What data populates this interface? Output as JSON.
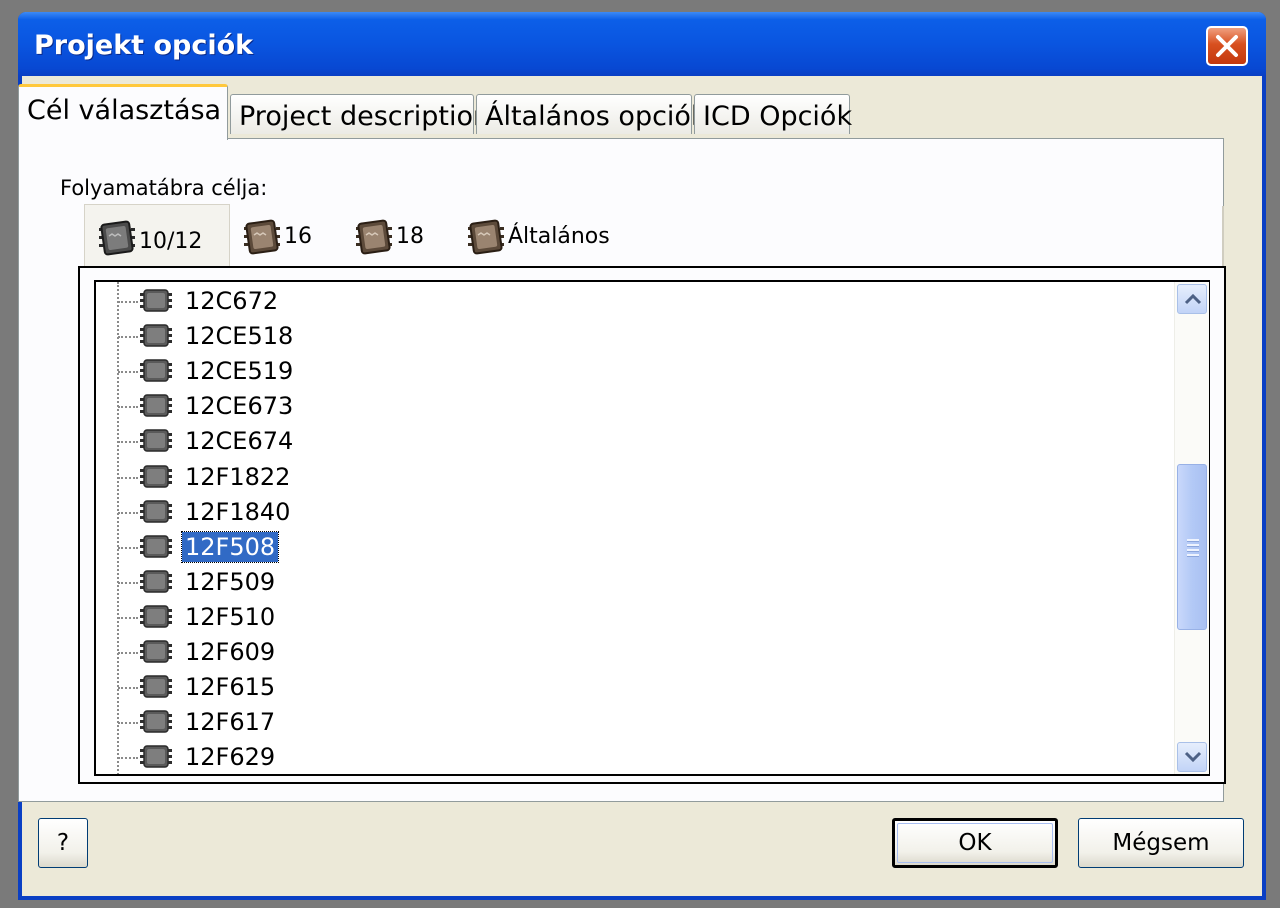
{
  "window": {
    "title": "Projekt opciók",
    "accent": "#0a55e0",
    "close_color": "#d8501f"
  },
  "tabs": [
    {
      "label": "Cél választása",
      "active": true
    },
    {
      "label": "Project description",
      "active": false
    },
    {
      "label": "Általános opciók",
      "active": false
    },
    {
      "label": "ICD Opciók",
      "active": false
    }
  ],
  "panel": {
    "label": "Folyamatábra célja:"
  },
  "subtabs": [
    {
      "label": "10/12",
      "icon": "chip-icon",
      "active": true
    },
    {
      "label": "16",
      "icon": "chip-icon",
      "active": false
    },
    {
      "label": "18",
      "icon": "chip-icon",
      "active": false
    },
    {
      "label": "Általános",
      "icon": "chip-icon",
      "active": false
    }
  ],
  "tree": {
    "items": [
      {
        "label": "12C672",
        "selected": false
      },
      {
        "label": "12CE518",
        "selected": false
      },
      {
        "label": "12CE519",
        "selected": false
      },
      {
        "label": "12CE673",
        "selected": false
      },
      {
        "label": "12CE674",
        "selected": false
      },
      {
        "label": "12F1822",
        "selected": false
      },
      {
        "label": "12F1840",
        "selected": false
      },
      {
        "label": "12F508",
        "selected": true
      },
      {
        "label": "12F509",
        "selected": false
      },
      {
        "label": "12F510",
        "selected": false
      },
      {
        "label": "12F609",
        "selected": false
      },
      {
        "label": "12F615",
        "selected": false
      },
      {
        "label": "12F617",
        "selected": false
      },
      {
        "label": "12F629",
        "selected": false
      }
    ],
    "selection_color": "#316ac5"
  },
  "buttons": {
    "help": "?",
    "ok": "OK",
    "cancel": "Mégsem"
  }
}
